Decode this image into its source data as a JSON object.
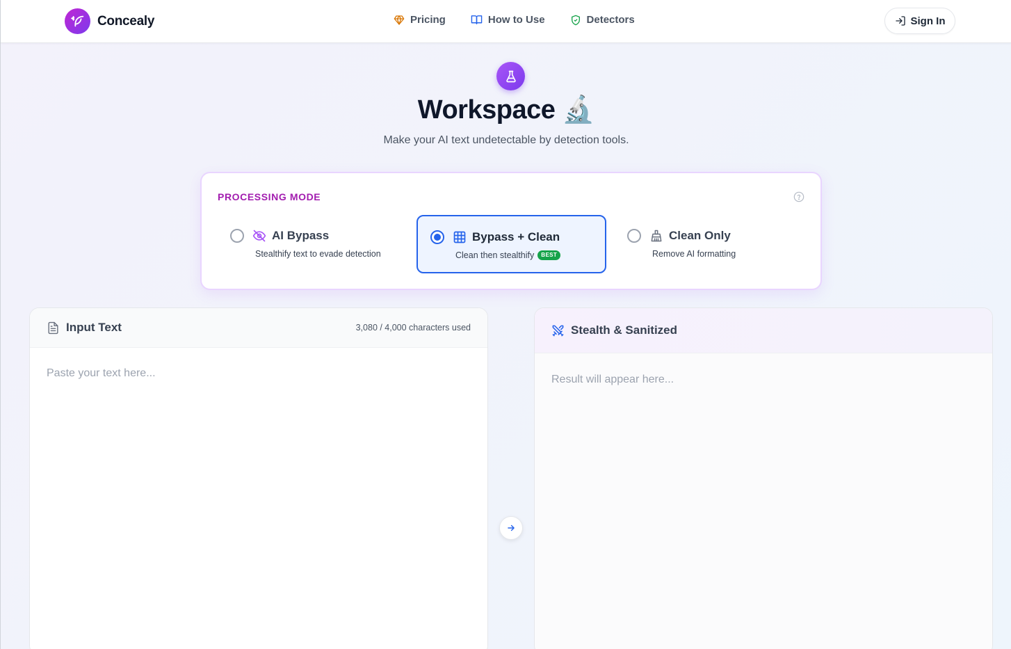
{
  "app": {
    "name": "Concealy"
  },
  "nav": {
    "items": [
      {
        "label": "Pricing",
        "icon": "gem-icon"
      },
      {
        "label": "How to Use",
        "icon": "book-open-icon"
      },
      {
        "label": "Detectors",
        "icon": "shield-check-icon"
      }
    ],
    "sign_in": "Sign In"
  },
  "hero": {
    "title": "Workspace 🔬",
    "subtitle": "Make your AI text undetectable by detection tools."
  },
  "processing_mode": {
    "title": "PROCESSING MODE",
    "selected": "Bypass + Clean",
    "options": [
      {
        "label": "AI Bypass",
        "description": "Stealthify text to evade detection",
        "icon": "eye-off-icon",
        "selected": false
      },
      {
        "label": "Bypass + Clean",
        "description": "Clean then stealthify",
        "badge": "BEST",
        "icon": "grid-icon",
        "selected": true
      },
      {
        "label": "Clean Only",
        "description": "Remove AI formatting",
        "icon": "brush-icon",
        "selected": false
      }
    ]
  },
  "input_panel": {
    "title": "Input Text",
    "char_count": "3,080 / 4,000 characters used",
    "placeholder": "Paste your text here...",
    "value": ""
  },
  "output_panel": {
    "title": "Stealth & Sanitized",
    "placeholder": "Result will appear here..."
  },
  "colors": {
    "brand": "#9333ea",
    "accent": "#2563eb",
    "mode_title": "#a21caf",
    "best_badge": "#16a34a"
  }
}
